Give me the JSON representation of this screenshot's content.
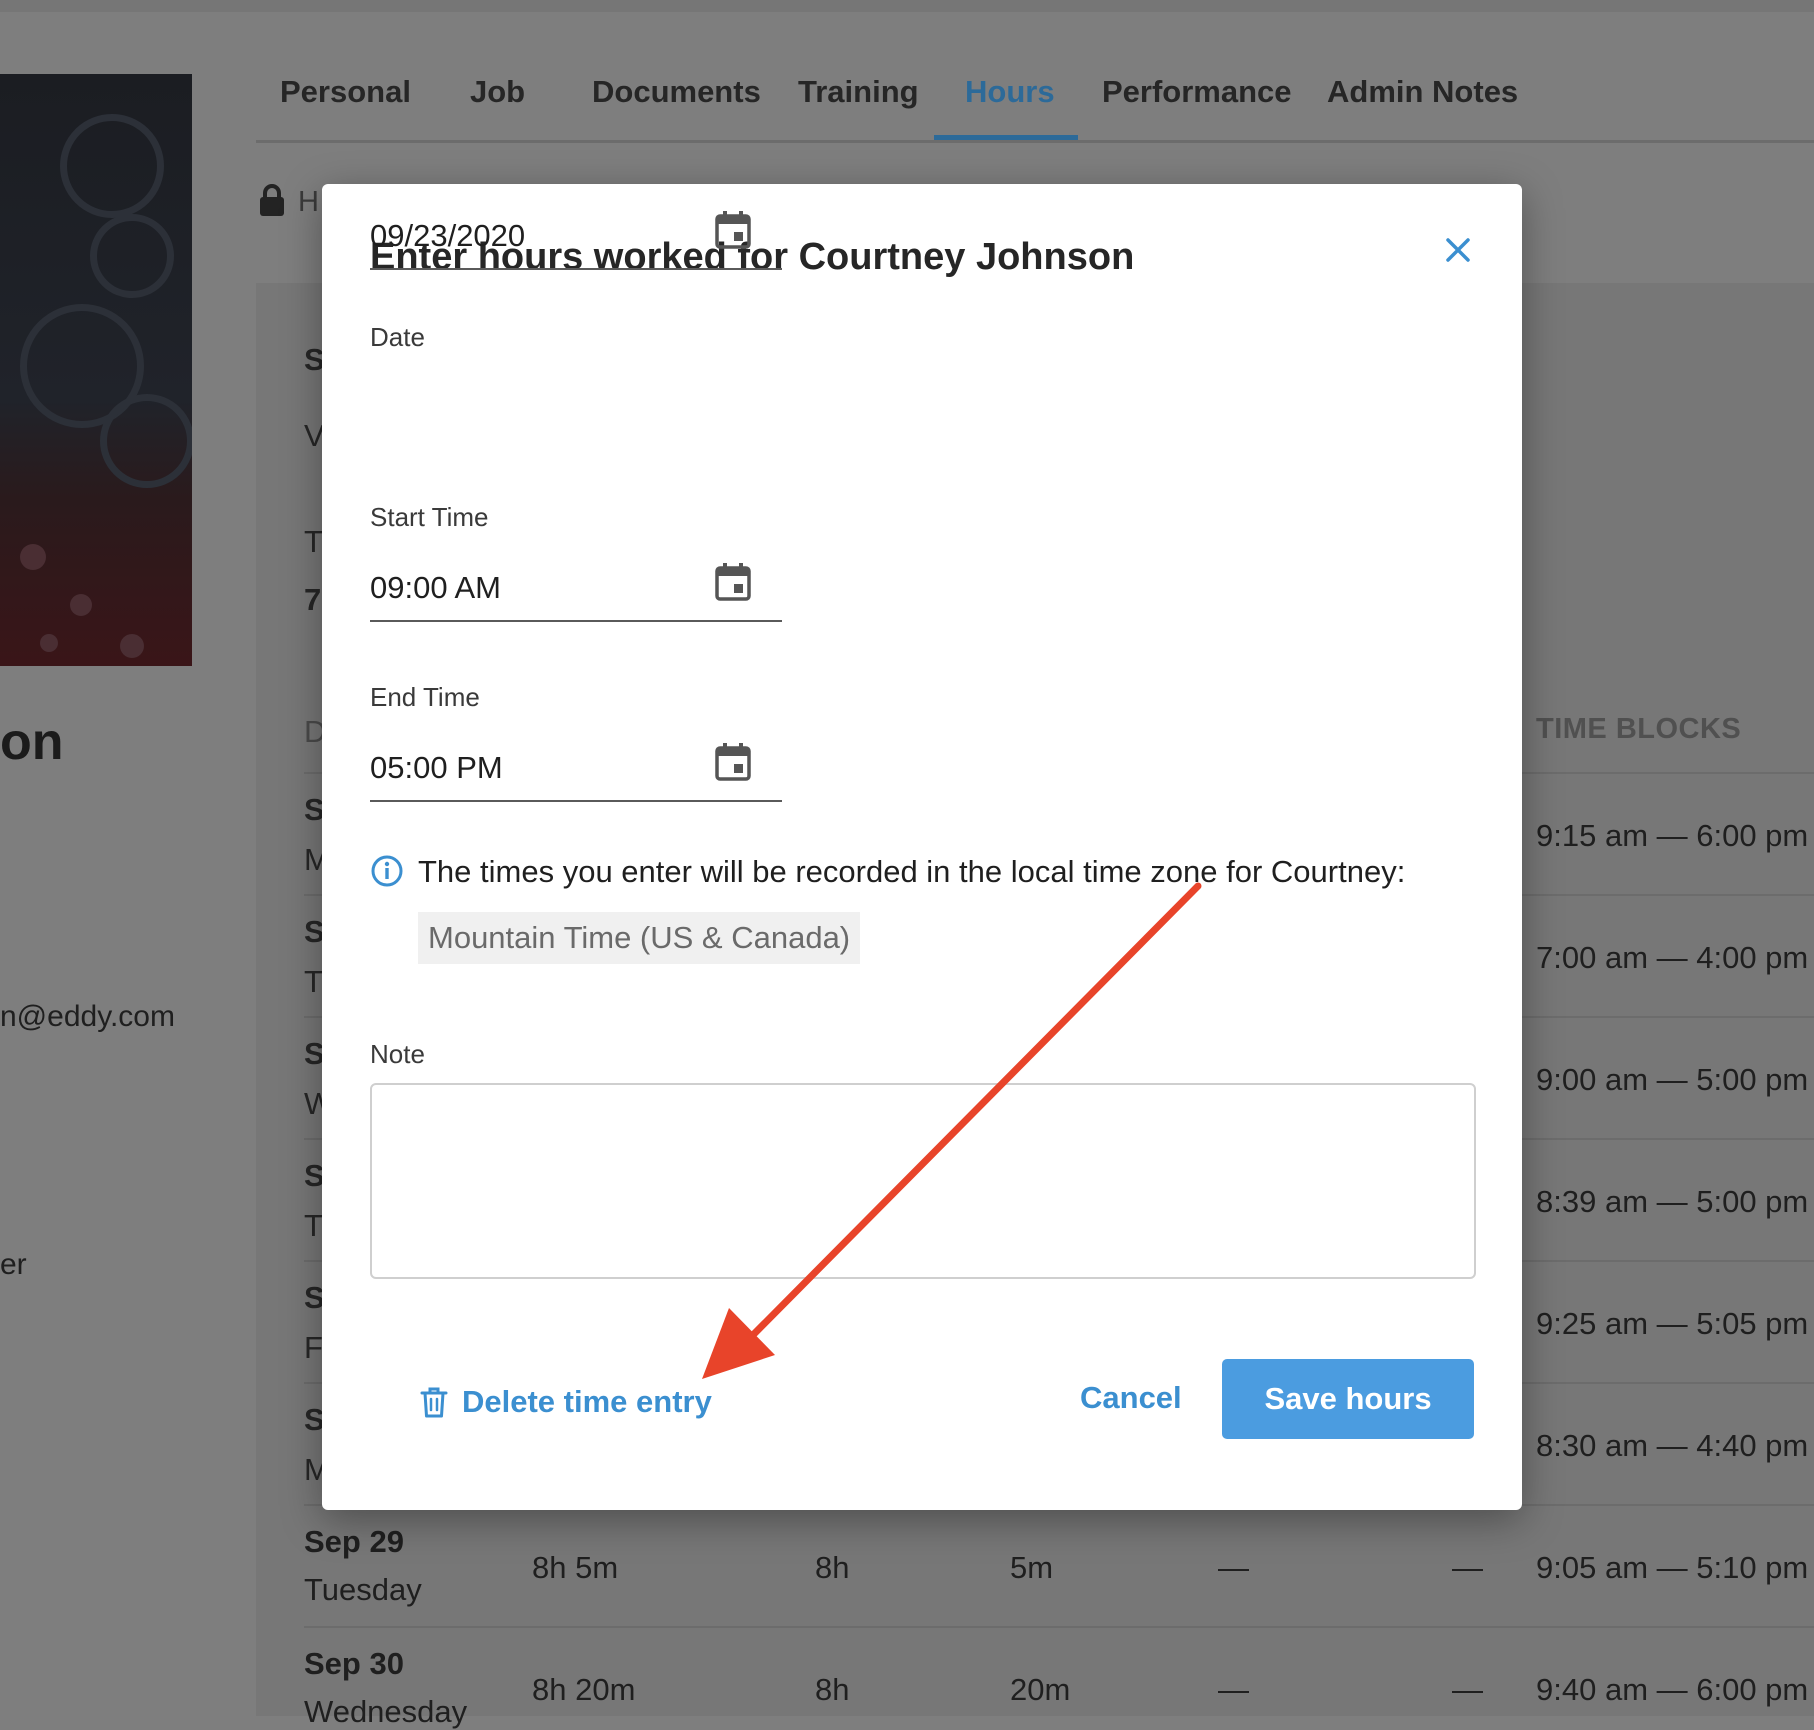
{
  "tabs": {
    "personal": "Personal",
    "job": "Job",
    "documents": "Documents",
    "training": "Training",
    "hours": "Hours",
    "performance": "Performance",
    "admin_notes": "Admin Notes",
    "active": "Hours"
  },
  "background": {
    "name_fragment": "on",
    "email_fragment": "n@eddy.com",
    "role_fragment": "er",
    "lock_fragment": "H",
    "left_fragments": [
      "S",
      "V",
      "T",
      "7",
      "D"
    ],
    "time_blocks_header": "TIME BLOCKS",
    "rows": [
      {
        "day_letter": "S",
        "weekday_letter": "M",
        "time_block": "9:15 am — 6:00 pm"
      },
      {
        "day_letter": "S",
        "weekday_letter": "T",
        "time_block": "7:00 am — 4:00 pm"
      },
      {
        "day_letter": "S",
        "weekday_letter": "W",
        "time_block": "9:00 am — 5:00 pm"
      },
      {
        "day_letter": "S",
        "weekday_letter": "T",
        "time_block": "8:39 am — 5:00 pm"
      },
      {
        "day_letter": "S",
        "weekday_letter": "F",
        "time_block": "9:25 am — 5:05 pm"
      },
      {
        "day_letter": "S",
        "weekday_letter": "M",
        "time_block": "8:30 am — 4:40 pm"
      },
      {
        "date": "Sep 29",
        "weekday": "Tuesday",
        "total": "8h 5m",
        "regular": "8h",
        "overtime": "5m",
        "col4": "—",
        "col5": "—",
        "time_block": "9:05 am — 5:10 pm"
      },
      {
        "date": "Sep 30",
        "weekday": "Wednesday",
        "total": "8h 20m",
        "regular": "8h",
        "overtime": "20m",
        "col4": "—",
        "col5": "—",
        "time_block": "9:40 am — 6:00 pm"
      }
    ]
  },
  "modal": {
    "title": "Enter hours worked for Courtney Johnson",
    "date_label": "Date",
    "date_value": "09/23/2020",
    "start_label": "Start Time",
    "start_value": "09:00 AM",
    "end_label": "End Time",
    "end_value": "05:00 PM",
    "info_text": "The times you enter will be recorded in the local time zone for Courtney:",
    "timezone": "Mountain Time (US & Canada)",
    "note_label": "Note",
    "note_value": "",
    "delete_label": "Delete time entry",
    "cancel_label": "Cancel",
    "save_label": "Save hours"
  },
  "colors": {
    "accent": "#3b8fd0",
    "save_button": "#4b9ce0",
    "active_tab": "#2c6a99",
    "annotation_arrow": "#e8442a"
  },
  "icons": {
    "close": "close-icon",
    "calendar": "calendar-icon",
    "info": "info-icon",
    "trash": "trash-icon",
    "lock": "lock-icon"
  }
}
